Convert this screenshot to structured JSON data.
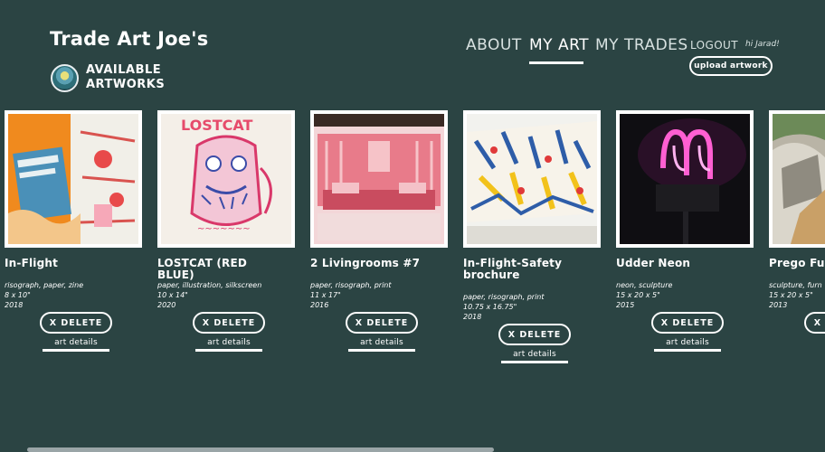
{
  "header": {
    "brand": "Trade Art Joe's",
    "collection_label": "AVAILABLE ARTWORKS",
    "avatar_icon": "profile-avatar"
  },
  "nav": {
    "about": "ABOUT",
    "my_art": "MY ART",
    "my_trades": "MY TRADES",
    "logout": "LOGOUT",
    "greeting": "hi Jarad!",
    "upload": "upload artwork",
    "active": "my_art"
  },
  "colors": {
    "background": "#2b4443",
    "text": "#ffffff"
  },
  "artworks": [
    {
      "title": "In-Flight",
      "materials": "risograph, paper, zine",
      "size": "8 x 10\"",
      "year": "2018",
      "delete": "X DELETE",
      "details": "art details"
    },
    {
      "title": "LOSTCAT (RED BLUE)",
      "materials": "paper, illustration, silkscreen",
      "size": "10 x 14\"",
      "year": "2020",
      "delete": "X DELETE",
      "details": "art details"
    },
    {
      "title": "2 Livingrooms #7",
      "materials": "paper, risograph, print",
      "size": "11 x 17\"",
      "year": "2016",
      "delete": "X DELETE",
      "details": "art details"
    },
    {
      "title": "In-Flight-Safety brochure",
      "materials": "paper, risograph, print",
      "size": "10.75 x 16.75\"",
      "year": "2018",
      "delete": "X DELETE",
      "details": "art details"
    },
    {
      "title": "Udder Neon",
      "materials": "neon, sculpture",
      "size": "15 x 20 x 5\"",
      "year": "2015",
      "delete": "X DELETE",
      "details": "art details"
    },
    {
      "title": "Prego Furn",
      "materials": "sculpture, furn",
      "size": "15 x 20 x 5\"",
      "year": "2013",
      "delete": "X DELETE",
      "details": "art details"
    }
  ]
}
